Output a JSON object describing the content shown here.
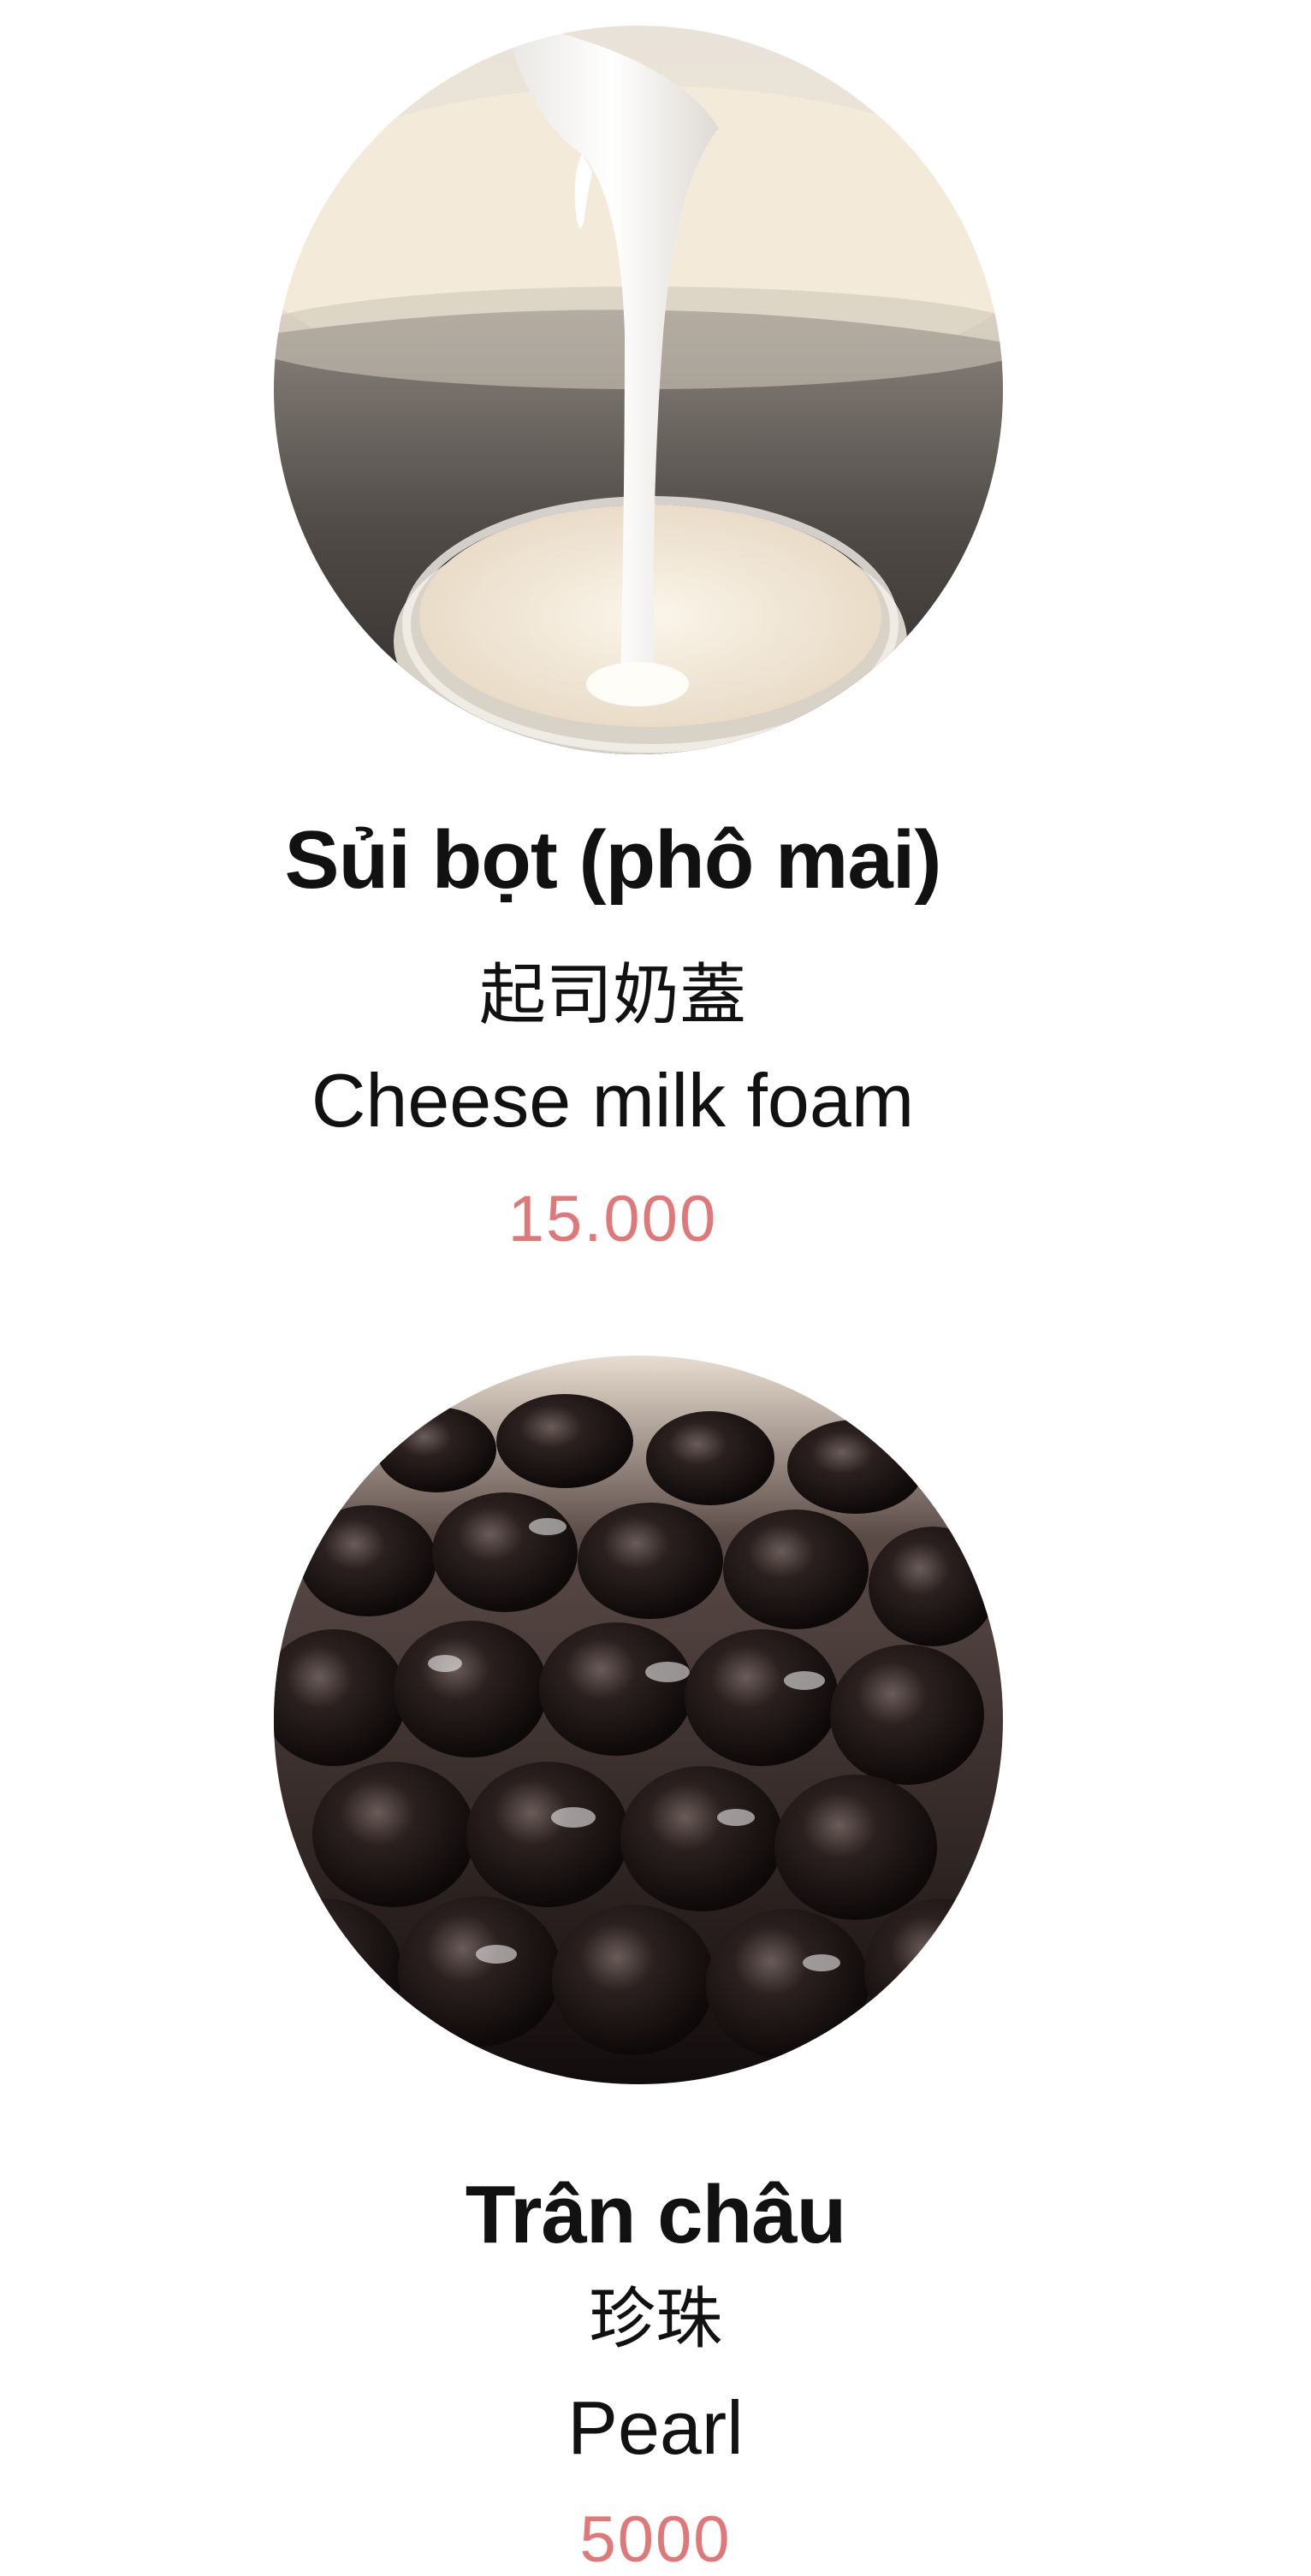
{
  "theme": {
    "price_color": "#e0787a",
    "text_color": "#111111",
    "background": "#ffffff"
  },
  "items": [
    {
      "name_vi": "Sủi bọt (phô mai)",
      "name_zh": "起司奶蓋",
      "name_en": "Cheese milk foam",
      "price": "15.000",
      "photo_icon": "cheese-foam-pour-photo"
    },
    {
      "name_vi": "Trân châu",
      "name_zh": "珍珠",
      "name_en": "Pearl",
      "price": "5000",
      "photo_icon": "tapioca-pearls-photo"
    }
  ]
}
